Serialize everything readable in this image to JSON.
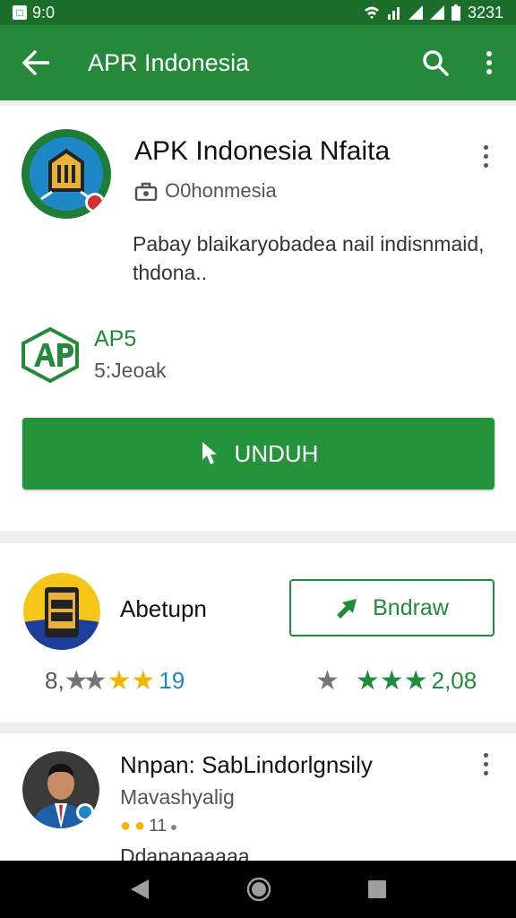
{
  "status_bar": {
    "left_icon": "notification-icon",
    "left_text": "9:0",
    "right_icons": [
      "wifi-icon",
      "signal-icon",
      "signal-icon",
      "signal-icon",
      "battery-icon"
    ],
    "time": "3231"
  },
  "app_bar": {
    "title": "APR Indonesia",
    "back_icon": "arrow-back-icon",
    "search_icon": "search-icon",
    "more_icon": "more-vert-icon"
  },
  "app_card": {
    "title": "APK Indonesia Nfaita",
    "developer": "O0honmesia",
    "description": "Pabay blaikaryobadea nail indisnmaid, thdona..",
    "apk_label": "AP5",
    "apk_size": "5:Jeoak",
    "download_label": "UNDUH"
  },
  "related_card": {
    "name": "Abetupn",
    "button_label": "Bndraw",
    "left_rating_prefix": "8,",
    "left_rating_value": "19",
    "right_rating_value": "2,08"
  },
  "comment_card": {
    "name": "Nnpan: SabLindorlgnsily",
    "subtitle": "Mavashyalig",
    "meta": "11",
    "text": "Ddananaaaaa"
  },
  "colors": {
    "primary": "#24893a",
    "status": "#1b6e2a",
    "star_gold": "#f4b400",
    "star_green": "#1e8c3a",
    "star_grey": "#757575"
  }
}
